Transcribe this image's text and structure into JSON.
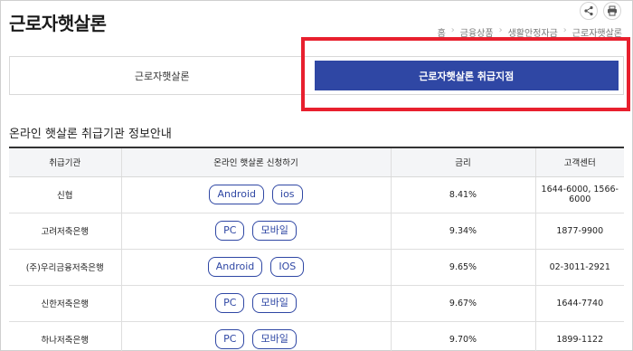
{
  "page": {
    "title": "근로자햇살론"
  },
  "breadcrumb": [
    "홈",
    "금융상품",
    "생활안정자금",
    "근로자햇살론"
  ],
  "tabs": [
    {
      "label": "근로자햇살론",
      "active": false
    },
    {
      "label": "근로자햇살론 취급지점",
      "active": true
    }
  ],
  "section_title": "온라인 햇살론 취급기관 정보안내",
  "table": {
    "headers": [
      "취급기관",
      "온라인 햇살론 신청하기",
      "금리",
      "고객센터"
    ],
    "rows": [
      {
        "institution": "신협",
        "buttons": [
          "Android",
          "ios"
        ],
        "rate": "8.41%",
        "phone": "1644-6000, 1566-6000"
      },
      {
        "institution": "고려저축은행",
        "buttons": [
          "PC",
          "모바일"
        ],
        "rate": "9.34%",
        "phone": "1877-9900"
      },
      {
        "institution": "(주)우리금융저축은행",
        "buttons": [
          "Android",
          "IOS"
        ],
        "rate": "9.65%",
        "phone": "02-3011-2921"
      },
      {
        "institution": "신한저축은행",
        "buttons": [
          "PC",
          "모바일"
        ],
        "rate": "9.67%",
        "phone": "1644-7740"
      },
      {
        "institution": "하나저축은행",
        "buttons": [
          "PC",
          "모바일"
        ],
        "rate": "9.70%",
        "phone": "1899-1122"
      }
    ]
  },
  "icons": {
    "share": "share-icon",
    "print": "print-icon"
  },
  "colors": {
    "accent": "#2f47a4",
    "highlight": "#e8202e",
    "header_bg": "#f4f5f7"
  }
}
